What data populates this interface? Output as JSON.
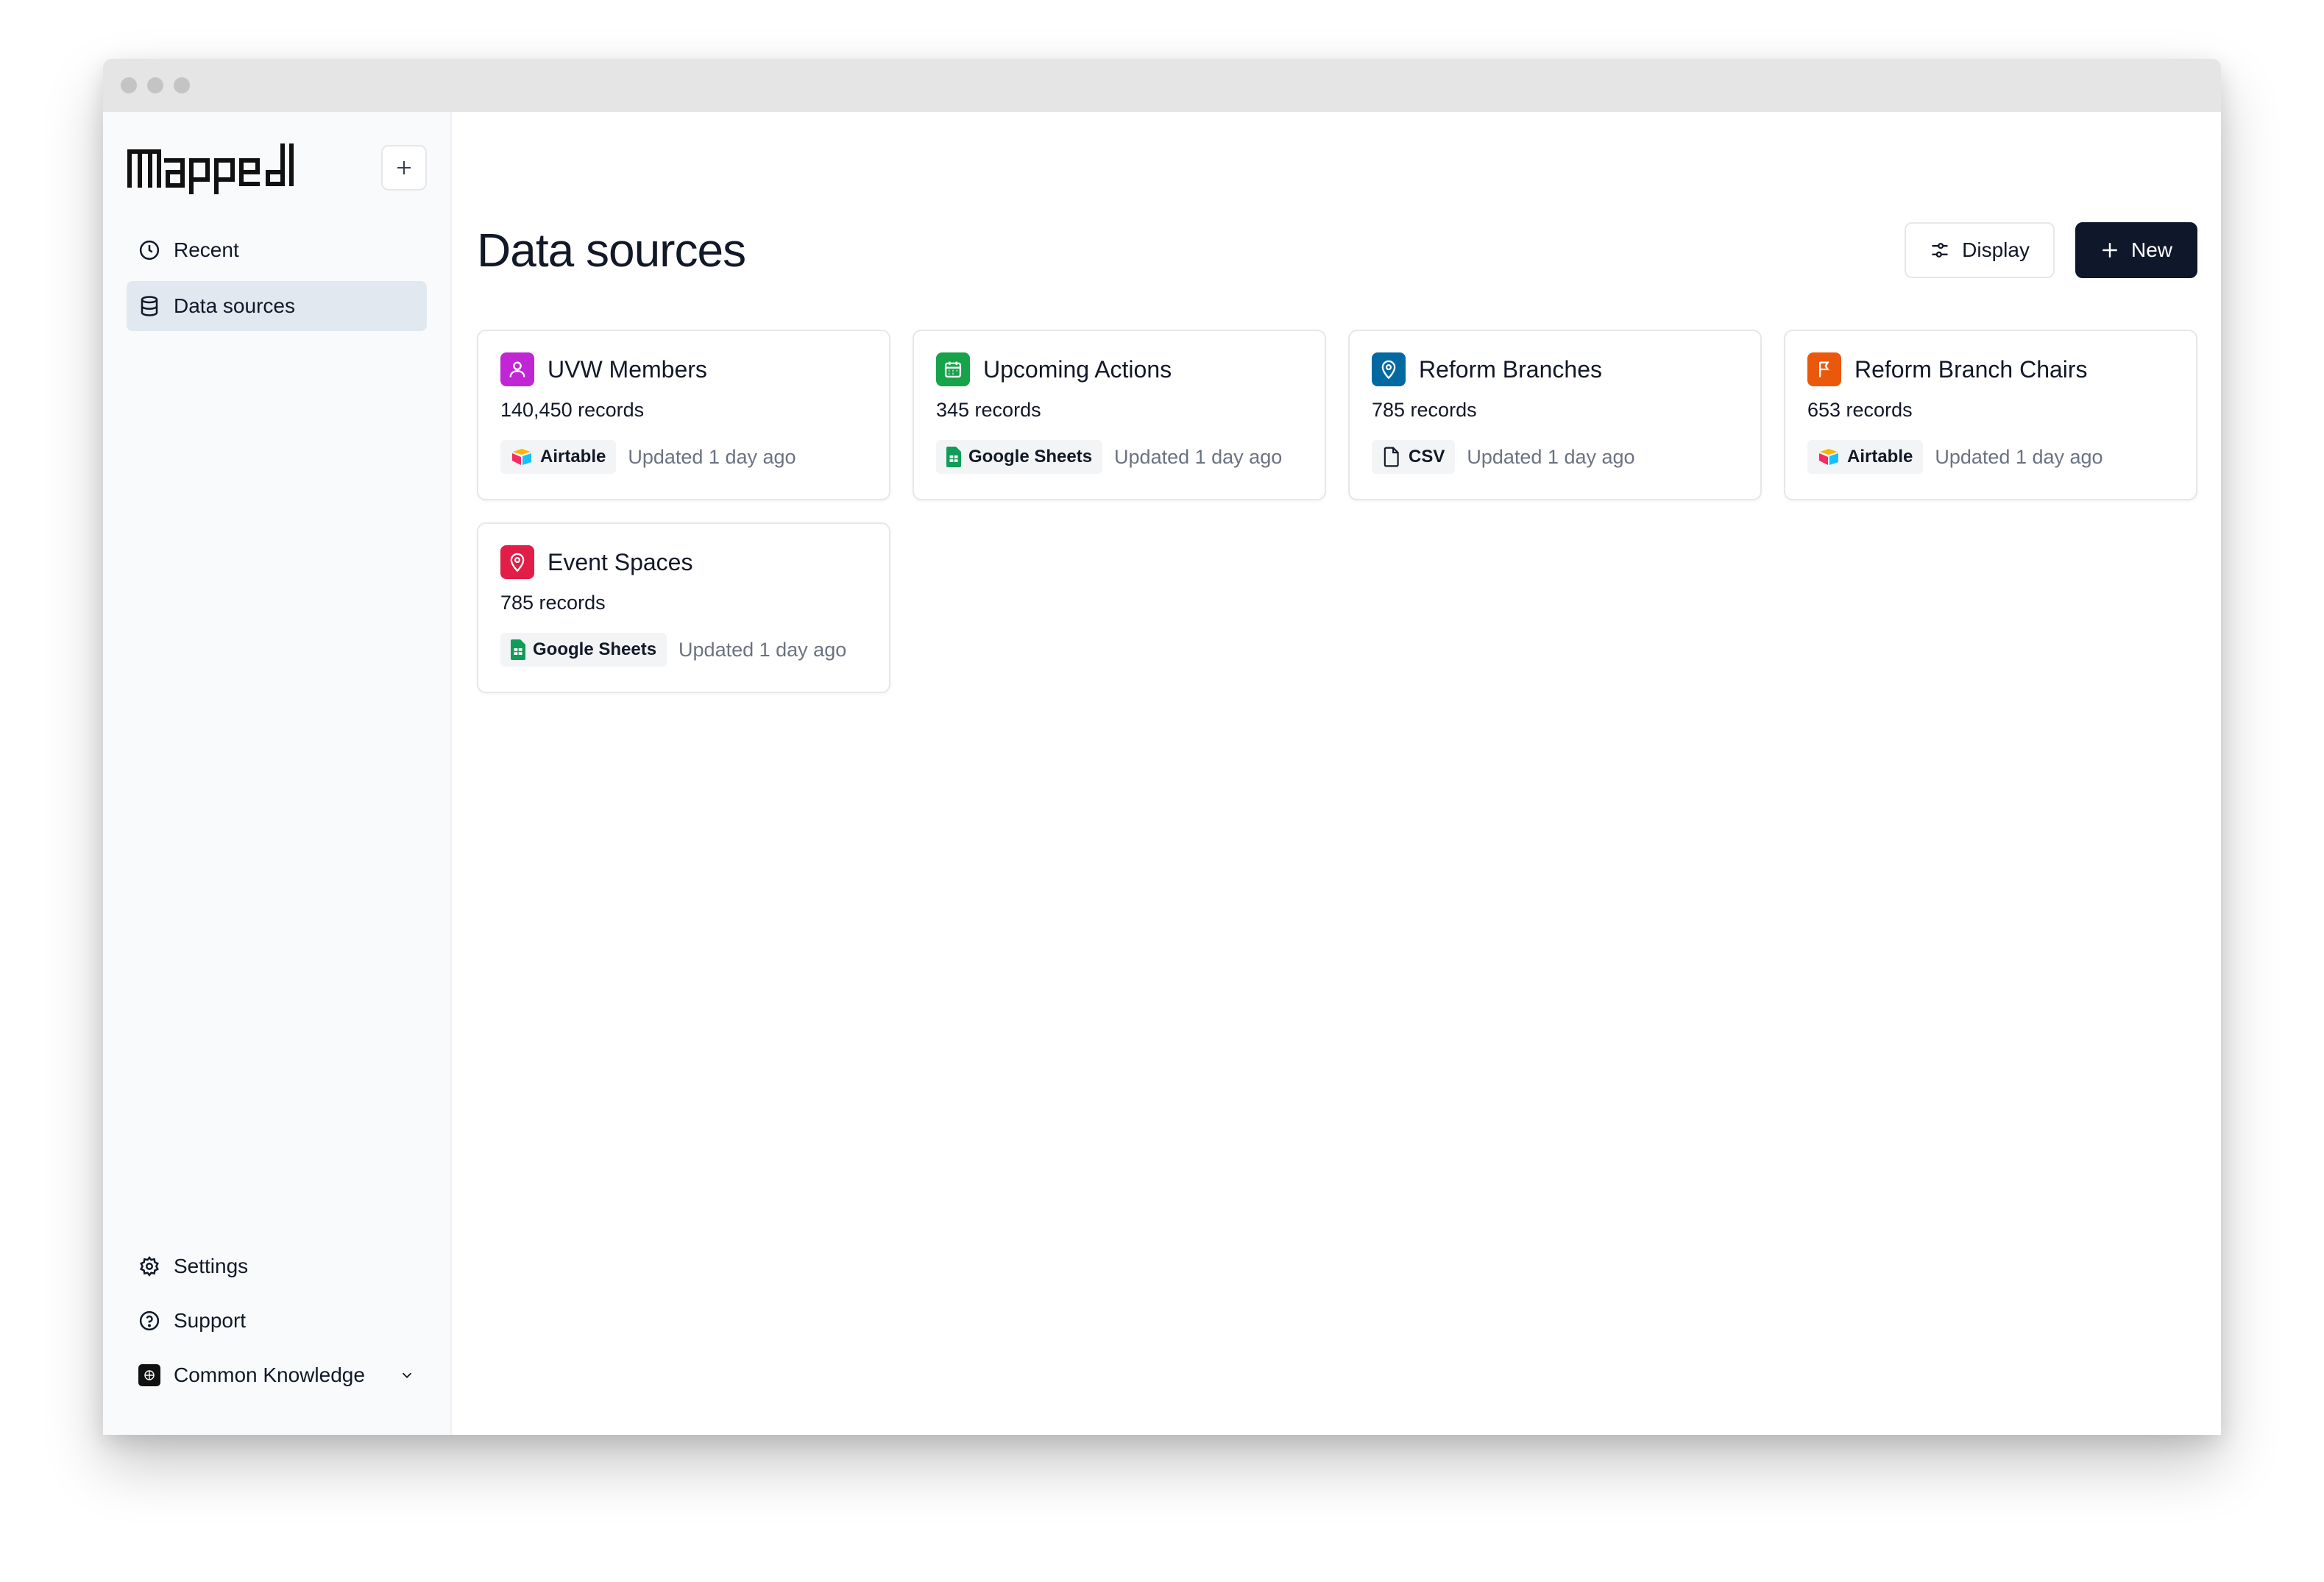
{
  "sidebar": {
    "nav": [
      {
        "label": "Recent",
        "icon": "clock-icon"
      },
      {
        "label": "Data sources",
        "icon": "database-icon"
      }
    ],
    "bottom": {
      "settings": "Settings",
      "support": "Support",
      "workspace": "Common Knowledge"
    }
  },
  "main": {
    "title": "Data sources",
    "display_label": "Display",
    "new_label": "New"
  },
  "cards": [
    {
      "title": "UVW Members",
      "count": "140,450 records",
      "source": "Airtable",
      "updated": "Updated 1 day ago",
      "icon": "user-icon",
      "color": "#c026d3"
    },
    {
      "title": "Upcoming Actions",
      "count": "345 records",
      "source": "Google Sheets",
      "updated": "Updated 1 day ago",
      "icon": "calendar-icon",
      "color": "#16a34a"
    },
    {
      "title": "Reform Branches",
      "count": "785 records",
      "source": "CSV",
      "updated": "Updated 1 day ago",
      "icon": "map-pin-icon",
      "color": "#0369a1"
    },
    {
      "title": "Reform Branch Chairs",
      "count": "653 records",
      "source": "Airtable",
      "updated": "Updated 1 day ago",
      "icon": "flag-icon",
      "color": "#ea580c"
    },
    {
      "title": "Event Spaces",
      "count": "785 records",
      "source": "Google Sheets",
      "updated": "Updated 1 day ago",
      "icon": "map-pin-icon",
      "color": "#e11d48"
    }
  ]
}
